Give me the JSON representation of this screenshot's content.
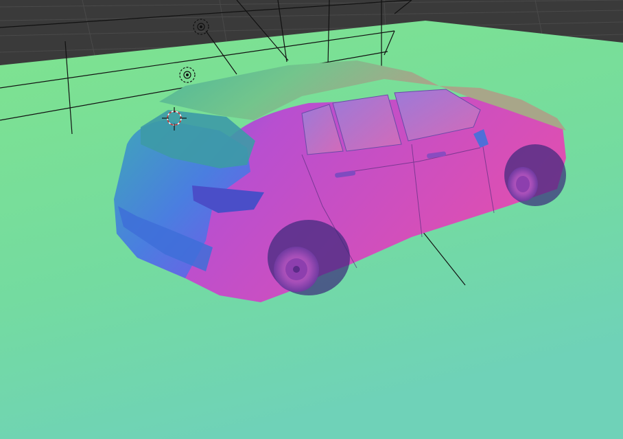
{
  "viewport": {
    "render_mode": "normal-map",
    "colors": {
      "background": "#3a3a3a",
      "grid_line": "#4a4a4a",
      "ground_near": "#6fd2b8",
      "ground_far": "#7fe38e",
      "car_body_side": "#c552c8",
      "car_body_rear": "#4a7ee0",
      "car_roof": "#5cbf8a",
      "wire": "#111111"
    }
  },
  "scene_objects": [
    {
      "name": "car-body",
      "kind": "mesh"
    },
    {
      "name": "ground-plane",
      "kind": "mesh"
    },
    {
      "name": "light-1",
      "kind": "light"
    },
    {
      "name": "light-2",
      "kind": "light"
    },
    {
      "name": "object-origin",
      "kind": "empty"
    }
  ],
  "icons": {
    "light": "light-icon",
    "origin": "origin-cursor-icon"
  }
}
